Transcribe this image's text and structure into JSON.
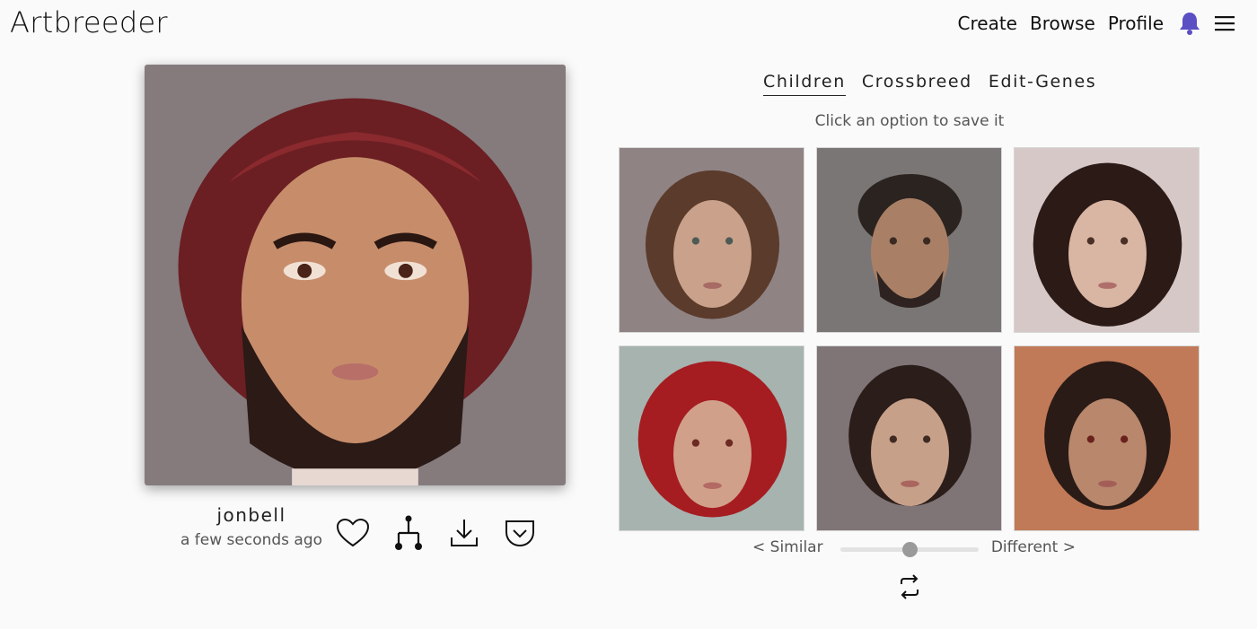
{
  "header": {
    "logo": "Artbreeder",
    "nav": [
      "Create",
      "Browse",
      "Profile"
    ],
    "icons": [
      "bell-icon",
      "menu-icon"
    ],
    "bell_color": "#5b4fc4"
  },
  "post": {
    "username": "jonbell",
    "timestamp": "a few seconds ago",
    "actions": [
      "heart-icon",
      "family-tree-icon",
      "download-icon",
      "save-to-collection-icon"
    ]
  },
  "tabs": [
    "Children",
    "Crossbreed",
    "Edit-Genes"
  ],
  "active_tab": "Children",
  "hint": "Click an option to save it",
  "children_count": 6,
  "slider": {
    "left_label": "< Similar",
    "right_label": "Different >",
    "value": 0.5
  }
}
